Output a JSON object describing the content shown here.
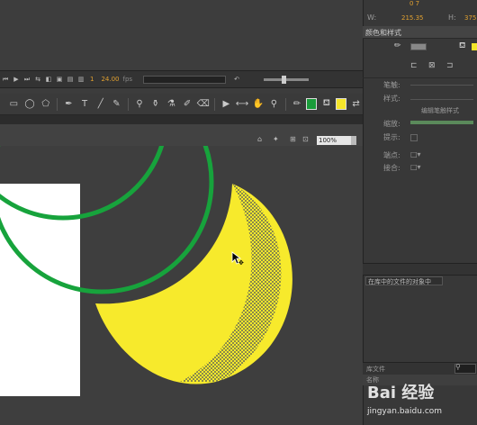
{
  "top_bar": {
    "readout_1": "0 7",
    "readout_2": "215.35",
    "readout_3": "375",
    "label_1": "W:",
    "label_2": "H:"
  },
  "timeline": {
    "frame": "1",
    "fps": "24.00",
    "fps_unit": "fps",
    "time": "0.0s"
  },
  "tools": {
    "icons": [
      "select-icon",
      "lasso-icon",
      "lasso-icon",
      "pen-icon",
      "text-icon",
      "line-icon",
      "pencil-icon",
      "brush-icon",
      "bone-icon",
      "paint-bucket-icon",
      "ink-bottle-icon",
      "eyedropper-icon",
      "eraser-icon",
      "camera-icon",
      "width-icon",
      "hand-icon",
      "zoom-icon",
      "pencil-icon"
    ],
    "stroke_color": "#1a9b3a",
    "fill_color": "#f5e52a"
  },
  "stage_header": {
    "zoom_value": "100%"
  },
  "stage": {
    "background": "#3e3e3e",
    "doc_color": "#ffffff",
    "circle_stroke": "#17a33c",
    "moon_fill": "#f7ea2c"
  },
  "right_panel": {
    "title": "颜色和样式",
    "label_stroke": "笔触:",
    "label_style": "样式:",
    "label_scale": "缩放:",
    "label_hint": "提示:",
    "label_cap": "端点:",
    "label_join": "接合:",
    "label_edit": "编辑笔触样式",
    "bottom_label": "在库中的文件的对象中",
    "library_label": "库文件",
    "library_item": "名称"
  },
  "watermark": {
    "line1": "Bai 经验",
    "line2": "jingyan.baidu.com"
  }
}
